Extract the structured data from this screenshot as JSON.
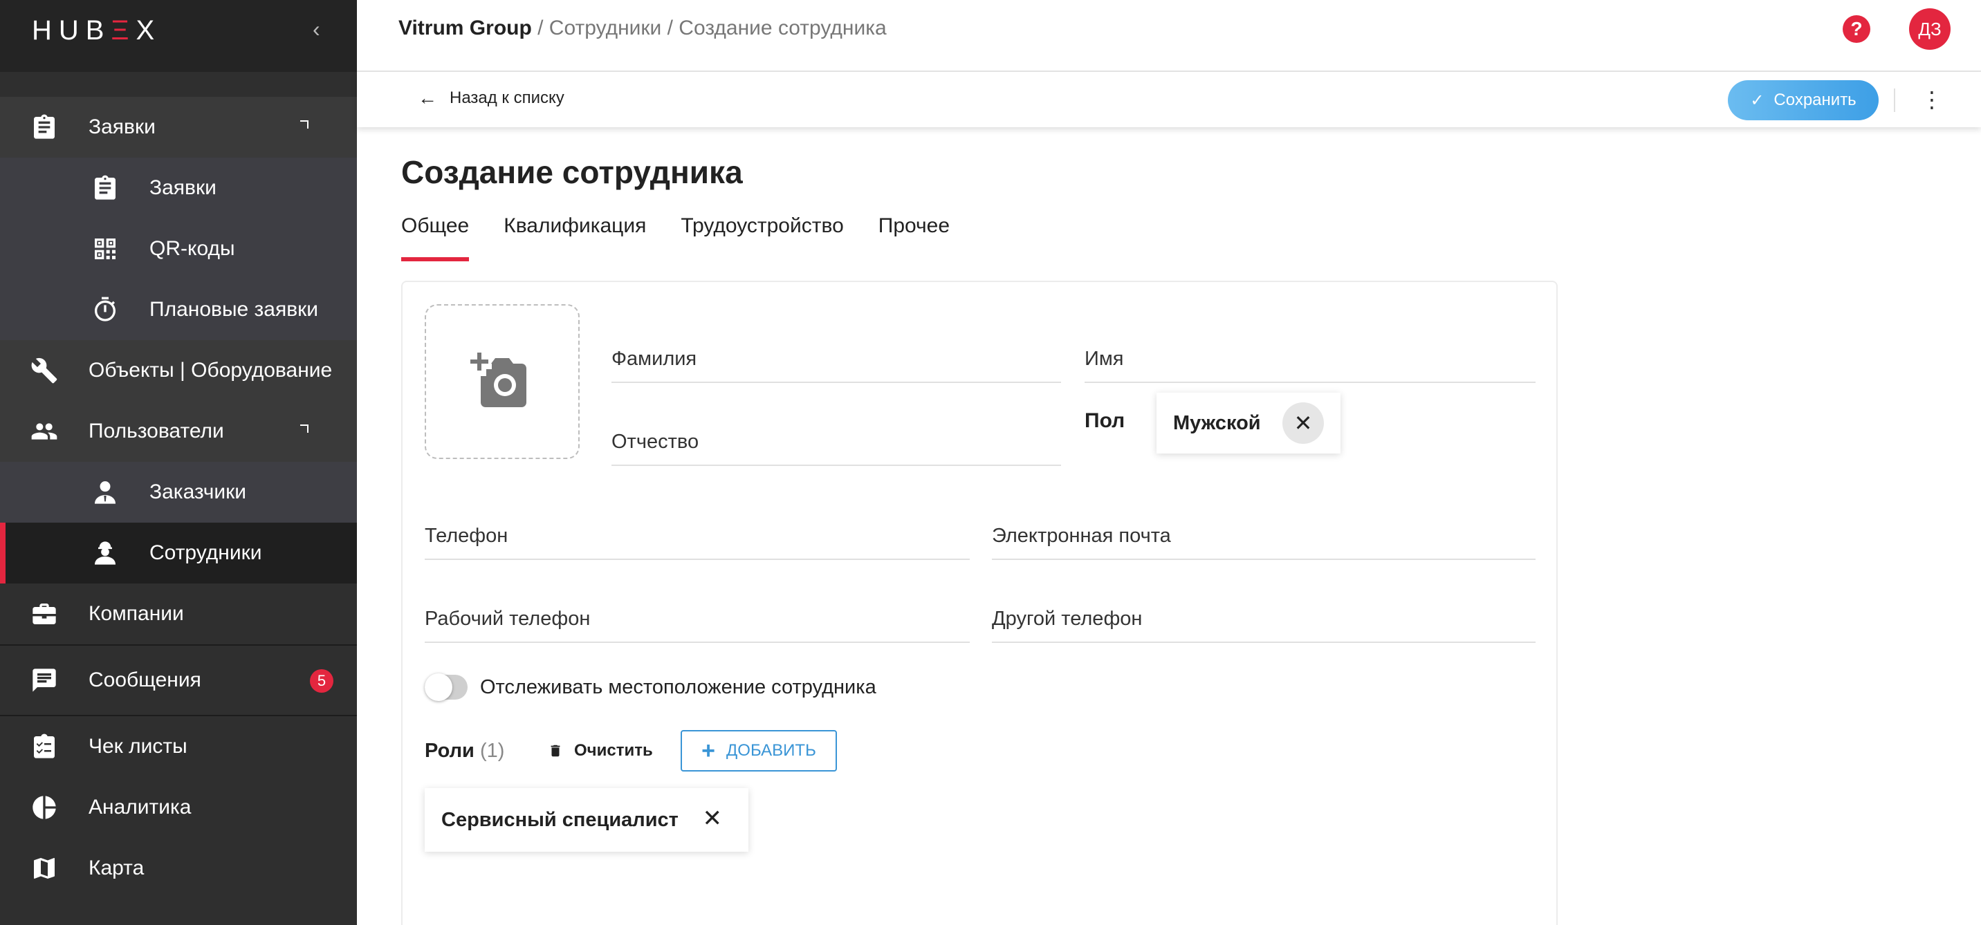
{
  "brand": {
    "logo_left": "HUB",
    "logo_e": "Ξ",
    "logo_right": "X",
    "accent_color": "#e3263f",
    "primary_color": "#3d9fe6"
  },
  "sidebar": {
    "collapse_icon": "chevron-left-icon",
    "items": [
      {
        "label": "Заявки",
        "icon": "clipboard-icon",
        "expanded": true
      },
      {
        "label": "Заявки",
        "icon": "clipboard-icon"
      },
      {
        "label": "QR-коды",
        "icon": "qr-code-icon"
      },
      {
        "label": "Плановые заявки",
        "icon": "timer-icon"
      },
      {
        "label": "Объекты | Оборудование",
        "icon": "wrench-icon"
      },
      {
        "label": "Пользователи",
        "icon": "users-icon",
        "expanded": true
      },
      {
        "label": "Заказчики",
        "icon": "customer-icon"
      },
      {
        "label": "Сотрудники",
        "icon": "worker-icon",
        "active": true
      },
      {
        "label": "Компании",
        "icon": "briefcase-icon"
      },
      {
        "label": "Сообщения",
        "icon": "message-icon",
        "badge": "5"
      },
      {
        "label": "Чек листы",
        "icon": "checklist-icon"
      },
      {
        "label": "Аналитика",
        "icon": "pie-chart-icon"
      },
      {
        "label": "Карта",
        "icon": "map-icon"
      }
    ]
  },
  "header": {
    "breadcrumb": [
      "Vitrum Group",
      " / Сотрудники",
      " / Создание сотрудника"
    ],
    "avatar_initials": "ДЗ",
    "help_glyph": "?"
  },
  "toolbar": {
    "back_label": "Назад к списку",
    "save_label": "Сохранить",
    "more_glyph": "⋮"
  },
  "page": {
    "title": "Создание сотрудника",
    "tabs": [
      {
        "label": "Общее",
        "active": true
      },
      {
        "label": "Квалификация"
      },
      {
        "label": "Трудоустройство"
      },
      {
        "label": "Прочее"
      }
    ]
  },
  "form": {
    "last_name": "Фамилия",
    "first_name": "Имя",
    "middle_name": "Отчество",
    "gender_label": "Пол",
    "gender_value": "Мужской",
    "phone": "Телефон",
    "email": "Электронная почта",
    "work_phone": "Рабочий телефон",
    "other_phone": "Другой телефон",
    "track_location_label": "Отслеживать местоположение сотрудника",
    "track_location_on": false,
    "roles_label": "Роли",
    "roles_count": "(1)",
    "clear_label": "Очистить",
    "add_label": "ДОБАВИТЬ",
    "roles": [
      "Сервисный специалист"
    ]
  }
}
